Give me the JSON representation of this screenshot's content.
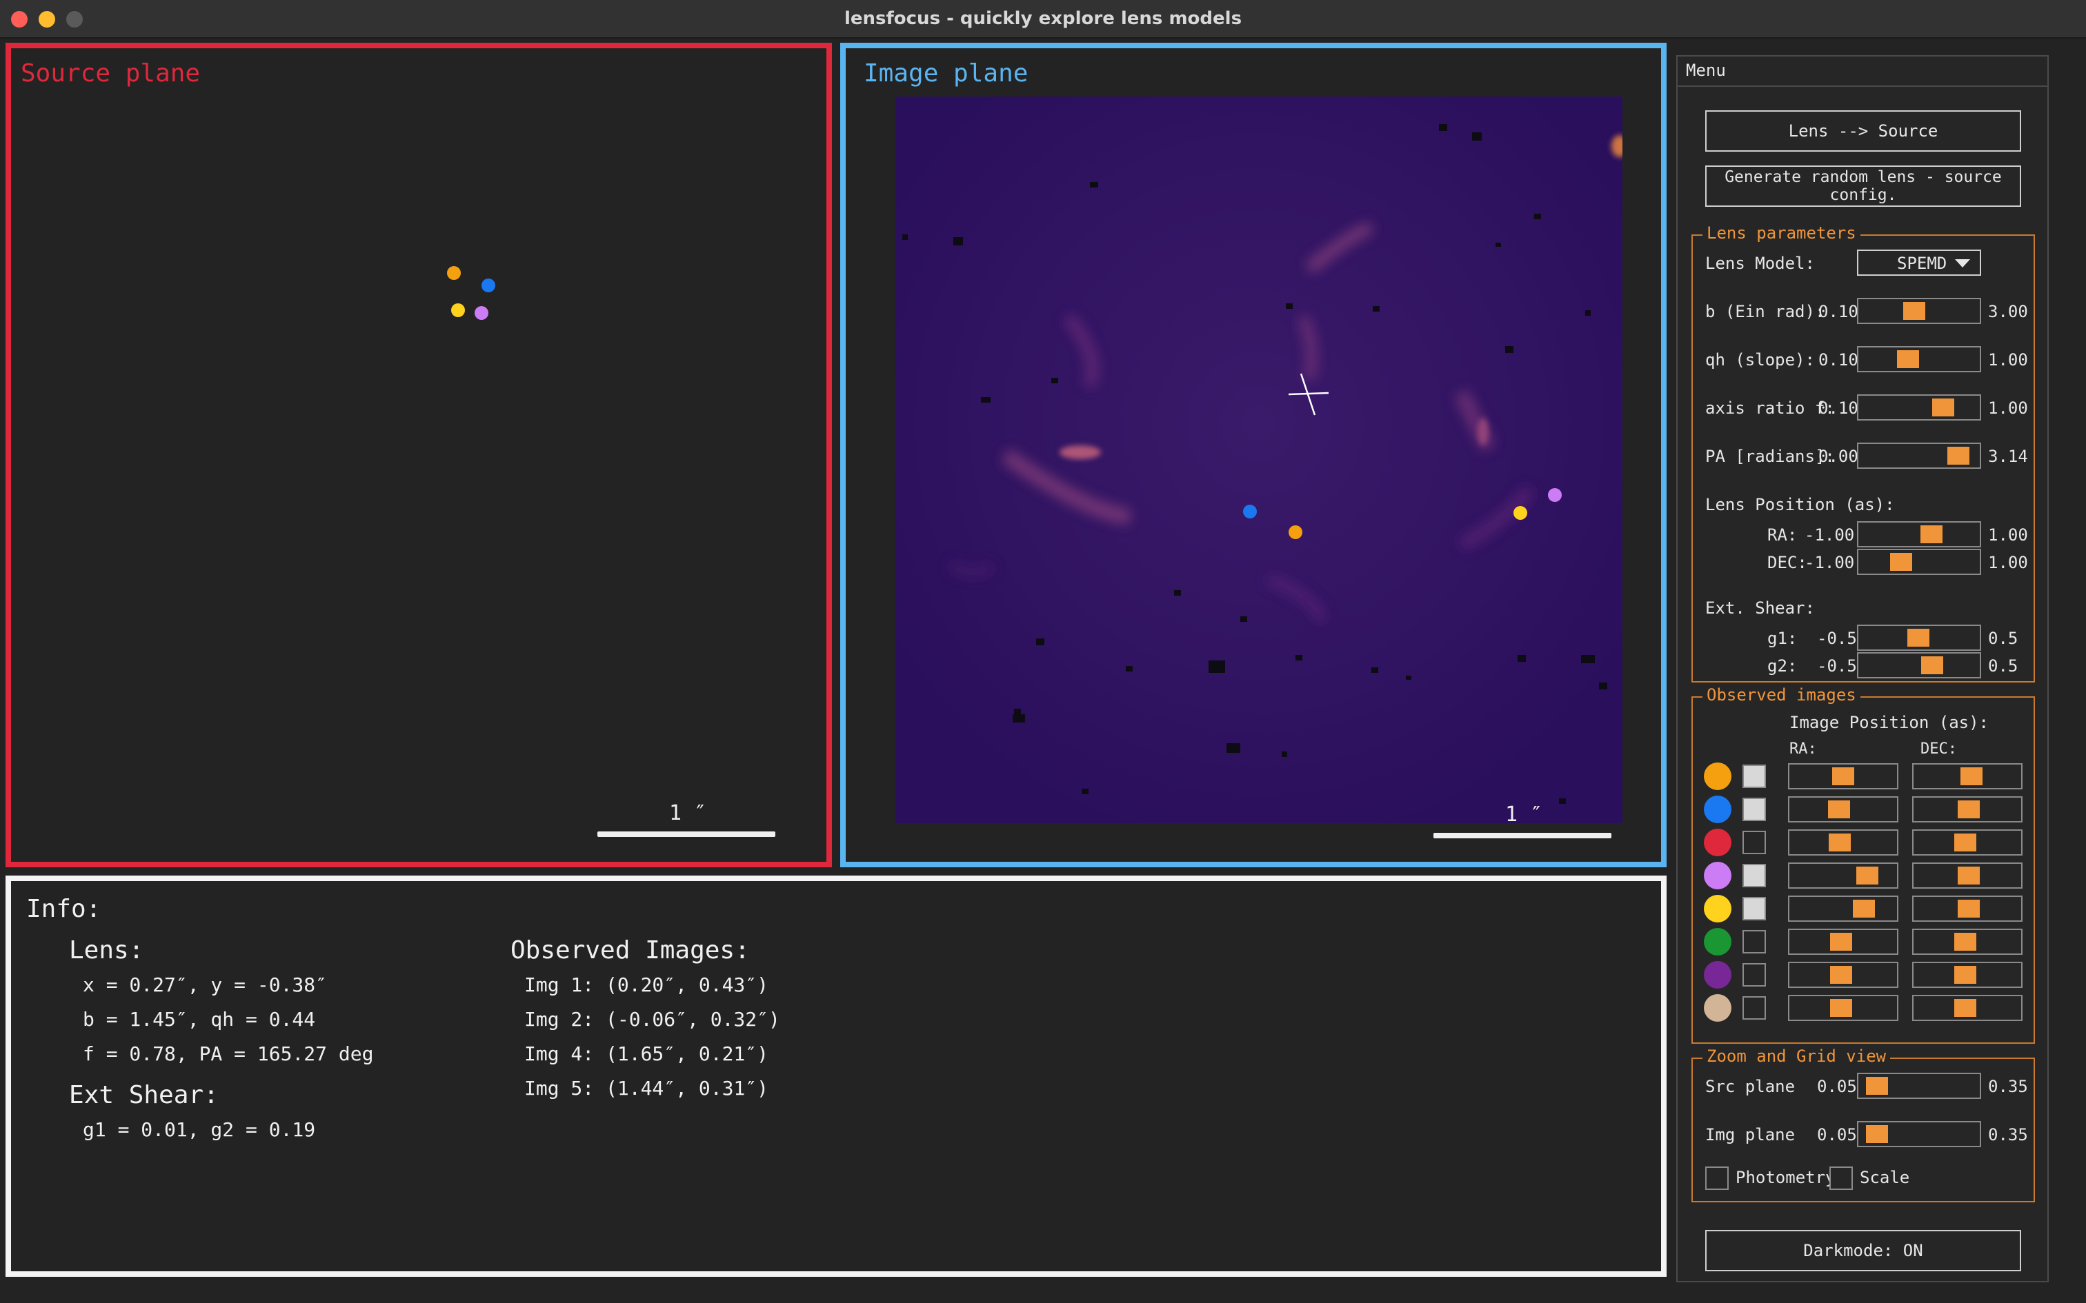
{
  "window": {
    "title": "lensfocus - quickly explore lens models",
    "controls": [
      {
        "name": "close",
        "color": "#ff5f57"
      },
      {
        "name": "minimize",
        "color": "#febc2e"
      },
      {
        "name": "zoom",
        "color": "#5a5a5a"
      }
    ]
  },
  "colors": {
    "source_border": "#e0283c",
    "image_border": "#5ab4f0",
    "info_border": "#f4f4f4",
    "accent": "#f0953a",
    "image_bg": "#2a0f5c"
  },
  "source_plane": {
    "title": "Source plane",
    "scale_label": "1 ″"
  },
  "image_plane": {
    "title": "Image plane",
    "scale_label": "1 ″"
  },
  "info": {
    "heading": "Info:",
    "lens_heading": "Lens:",
    "lens_lines": [
      "x = 0.27″, y = -0.38″",
      "b = 1.45″, qh = 0.44",
      "f = 0.78, PA = 165.27 deg"
    ],
    "shear_heading": "Ext Shear:",
    "shear_line": "g1 = 0.01, g2 = 0.19",
    "observed_heading": "Observed Images:",
    "observed_lines": [
      "Img 1: (0.20″, 0.43″)",
      "Img 2: (-0.06″, 0.32″)",
      "Img 4: (1.65″, 0.21″)",
      "Img 5: (1.44″, 0.31″)"
    ]
  },
  "menu": {
    "title": "Menu",
    "lens_to_source_button": "Lens --> Source",
    "random_button": "Generate random lens - source config.",
    "lens_params": {
      "label": "Lens parameters",
      "model_label": "Lens Model:",
      "model_value": "SPEMD",
      "sliders": [
        {
          "label": "b (Ein rad):",
          "min": "0.10",
          "max": "3.00",
          "fraction": 0.45
        },
        {
          "label": "qh (slope):",
          "min": "0.10",
          "max": "1.00",
          "fraction": 0.38
        },
        {
          "label": "axis ratio f:",
          "min": "0.10",
          "max": "1.00",
          "fraction": 0.76
        },
        {
          "label": "PA [radians]:",
          "min": "0.00",
          "max": "3.14",
          "fraction": 0.92
        }
      ],
      "position_label": "Lens Position (as):",
      "position_sliders": [
        {
          "label": "RA:",
          "min": "-1.00",
          "max": "1.00",
          "fraction": 0.63
        },
        {
          "label": "DEC:",
          "min": "-1.00",
          "max": "1.00",
          "fraction": 0.31
        }
      ],
      "shear_label": "Ext. Shear:",
      "shear_sliders": [
        {
          "label": "g1:",
          "min": "-0.5",
          "max": "0.5",
          "fraction": 0.49
        },
        {
          "label": "g2:",
          "min": "-0.5",
          "max": "0.5",
          "fraction": 0.64
        }
      ]
    },
    "observed": {
      "label": "Observed images",
      "position_label": "Image Position (as):",
      "ra_label": "RA:",
      "dec_label": "DEC:",
      "rows": [
        {
          "color": "#f5a00f",
          "checked": true,
          "ra": 0.5,
          "dec": 0.55
        },
        {
          "color": "#1a78f0",
          "checked": true,
          "ra": 0.45,
          "dec": 0.52
        },
        {
          "color": "#e0283c",
          "checked": false,
          "ra": 0.46,
          "dec": 0.47
        },
        {
          "color": "#cc7cf5",
          "checked": true,
          "ra": 0.8,
          "dec": 0.52
        },
        {
          "color": "#ffd21e",
          "checked": true,
          "ra": 0.76,
          "dec": 0.52
        },
        {
          "color": "#1a9632",
          "checked": false,
          "ra": 0.47,
          "dec": 0.47
        },
        {
          "color": "#782896",
          "checked": false,
          "ra": 0.47,
          "dec": 0.47
        },
        {
          "color": "#d2b496",
          "checked": false,
          "ra": 0.47,
          "dec": 0.47
        }
      ]
    },
    "zoom": {
      "label": "Zoom and Grid view",
      "sliders": [
        {
          "label": "Src plane",
          "min": "0.05",
          "max": "0.35",
          "fraction": 0.05
        },
        {
          "label": "Img plane",
          "min": "0.05",
          "max": "0.35",
          "fraction": 0.05
        }
      ],
      "photometry_label": "Photometry",
      "scale_label": "Scale"
    },
    "darkmode_button": "Darkmode: ON"
  }
}
